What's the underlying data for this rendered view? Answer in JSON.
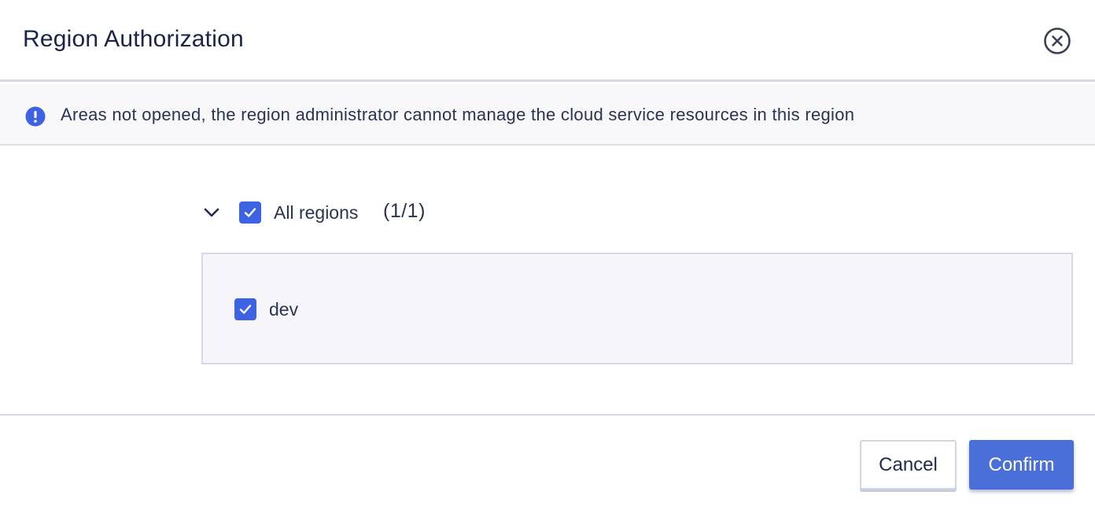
{
  "dialog": {
    "title": "Region Authorization",
    "close_icon": "close-circle-icon"
  },
  "notice": {
    "icon": "info-exclamation-icon",
    "text": "Areas not opened, the region administrator cannot manage the cloud service resources in this region"
  },
  "regions": {
    "expand_icon": "chevron-down-icon",
    "all_label": "All regions",
    "all_checked": true,
    "count": "(1/1)",
    "items": [
      {
        "label": "dev",
        "checked": true
      }
    ]
  },
  "footer": {
    "cancel_label": "Cancel",
    "confirm_label": "Confirm"
  },
  "colors": {
    "accent": "#3d62e2",
    "confirm_bg": "#4a6fd8",
    "notice_bg": "#f8f8fb",
    "region_box_bg": "#f5f5fa"
  }
}
